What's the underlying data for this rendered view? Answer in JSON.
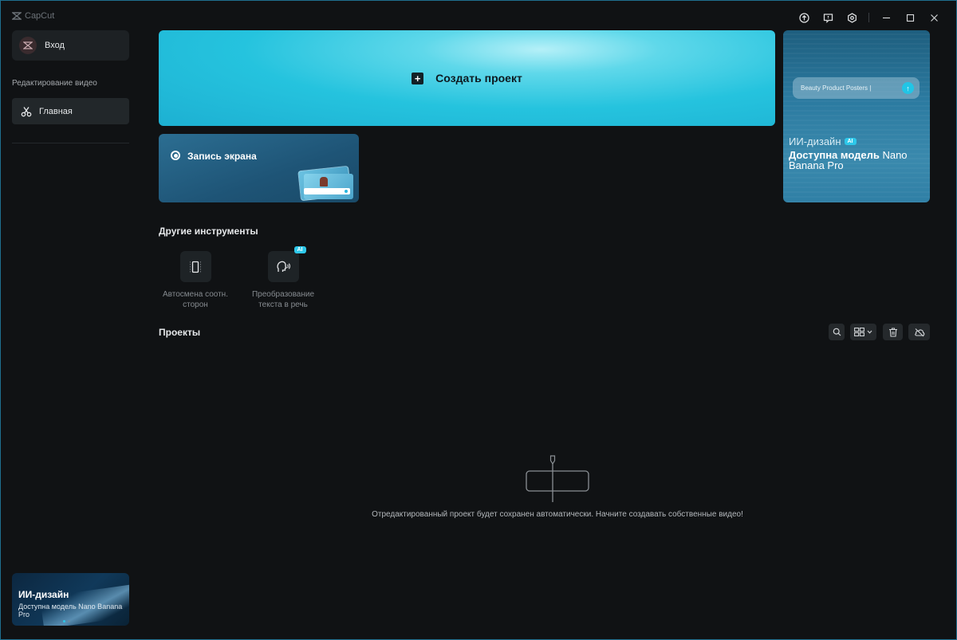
{
  "app": {
    "brand": "CapCut"
  },
  "sidebar": {
    "login_label": "Вход",
    "section_title": "Редактирование видео",
    "home_label": "Главная",
    "promo": {
      "title": "ИИ-дизайн",
      "subtitle": "Доступна модель Nano Banana Pro"
    }
  },
  "main": {
    "create_label": "Создать проект",
    "record_label": "Запись экрана",
    "ai_card": {
      "search_text": "Beauty Product Posters",
      "title": "ИИ-дизайн",
      "badge": "AI",
      "desc_bold": "Доступна модель",
      "desc_rest": " Nano Banana Pro"
    },
    "other_tools_title": "Другие инструменты",
    "tools": [
      {
        "label": "Автосмена соотн. сторон",
        "icon": "aspect-ratio-icon"
      },
      {
        "label": "Преобразование текста в речь",
        "icon": "text-to-speech-icon",
        "badge": "AI"
      }
    ],
    "projects_title": "Проекты",
    "empty_text": "Отредактированный проект будет сохранен автоматически. Начните создавать собственные видео!"
  },
  "colors": {
    "accent": "#2ec8ea",
    "background": "#101214"
  }
}
